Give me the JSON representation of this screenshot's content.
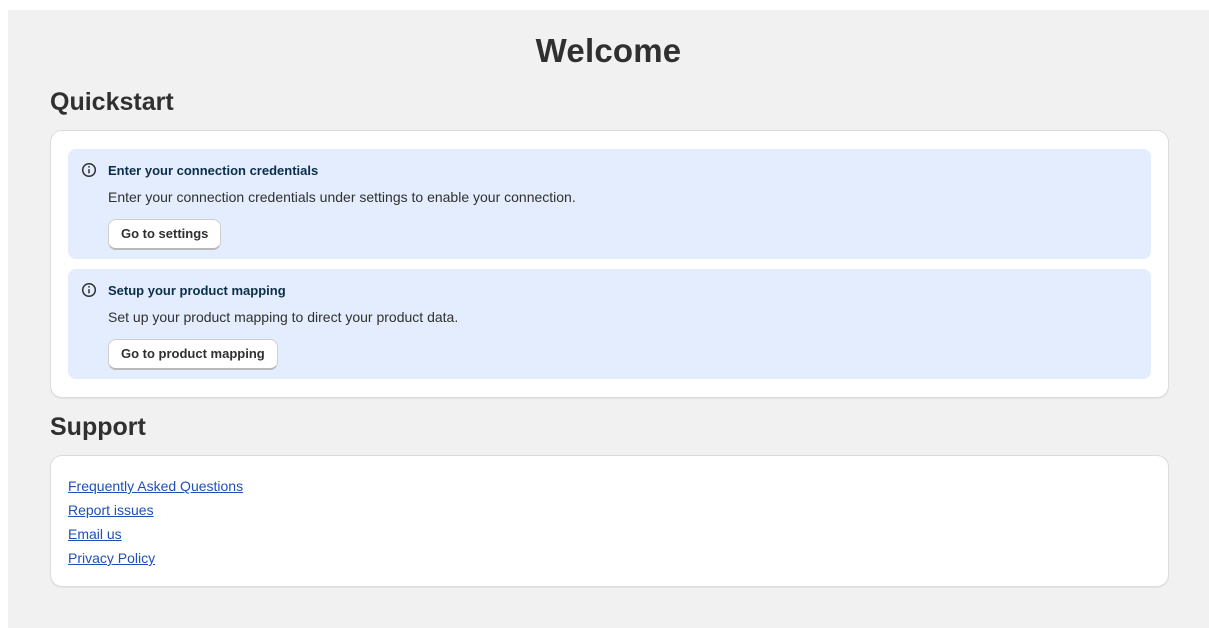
{
  "page": {
    "title": "Welcome"
  },
  "quickstart": {
    "heading": "Quickstart",
    "banners": [
      {
        "icon": "info-icon",
        "title": "Enter your connection credentials",
        "text": "Enter your connection credentials under settings to enable your connection.",
        "button_label": "Go to settings"
      },
      {
        "icon": "info-icon",
        "title": "Setup your product mapping",
        "text": "Set up your product mapping to direct your product data.",
        "button_label": "Go to product mapping"
      }
    ]
  },
  "support": {
    "heading": "Support",
    "links": [
      "Frequently Asked Questions",
      "Report issues",
      "Email us",
      "Privacy Policy"
    ]
  },
  "colors": {
    "page_background": "#f1f1f1",
    "banner_background": "#e3edfd",
    "banner_title": "#0b2e48",
    "link": "#1f4fb8"
  }
}
